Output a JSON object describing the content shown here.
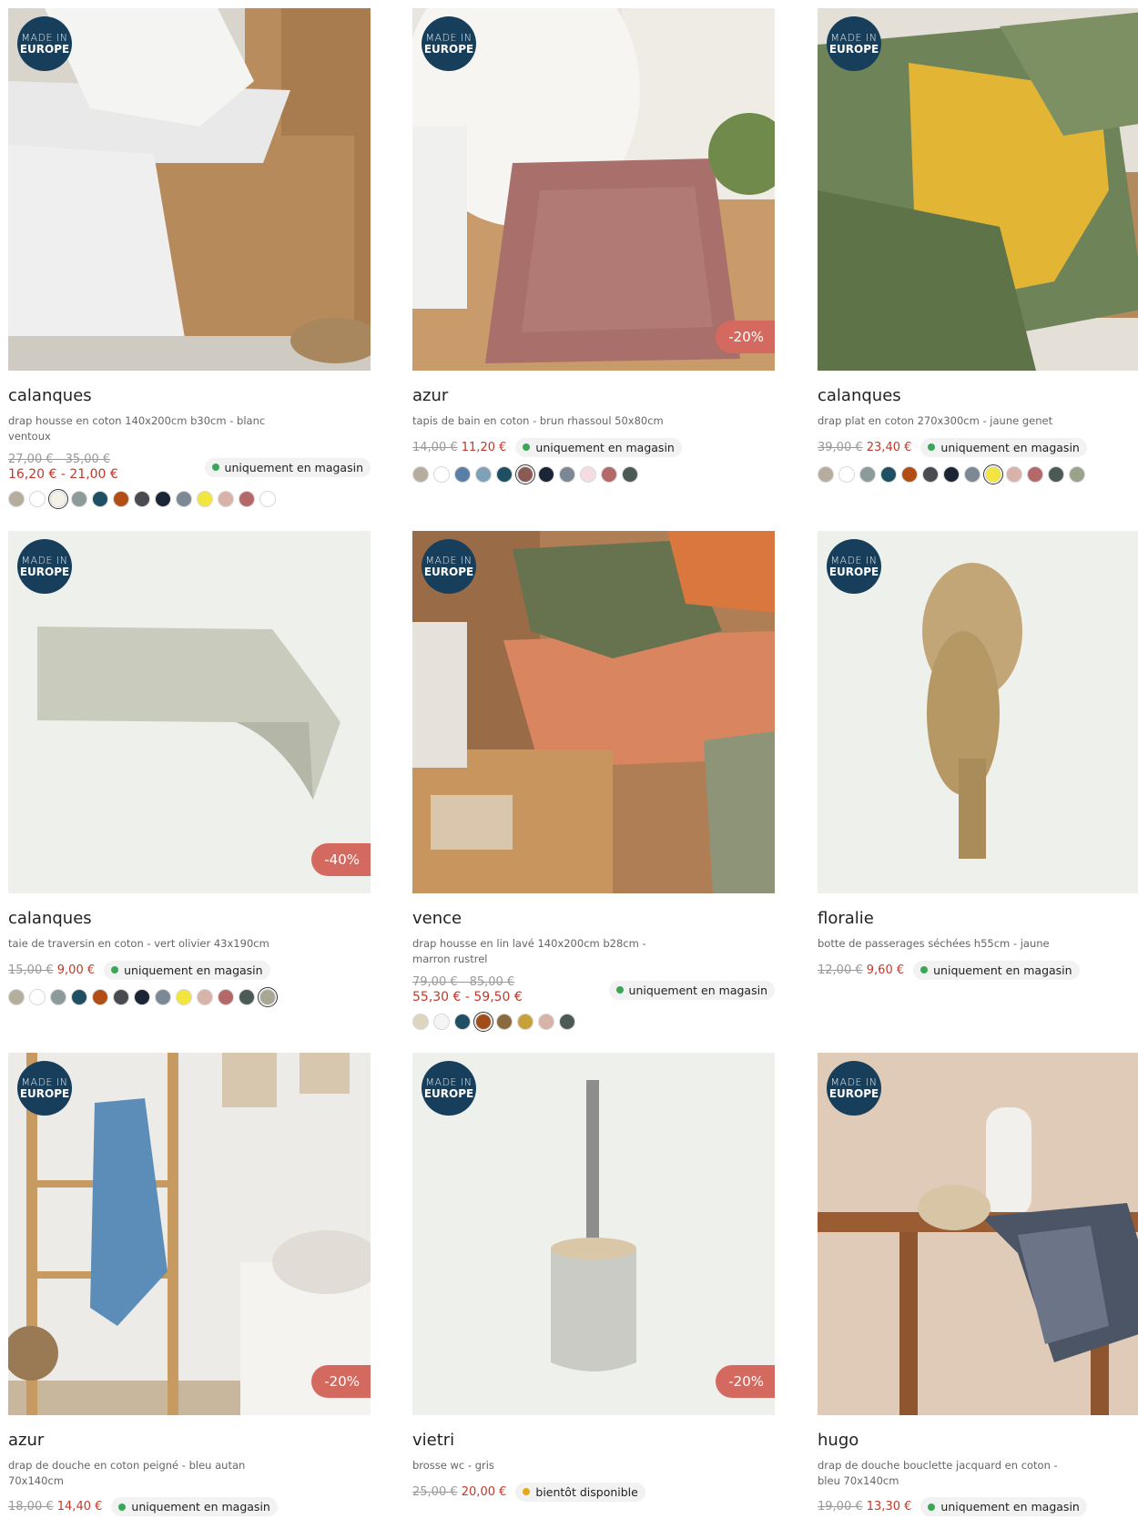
{
  "badge": {
    "line1": "MADE IN",
    "line2": "EUROPE"
  },
  "products": [
    {
      "name": "calanques",
      "desc": "drap housse en coton 140x200cm b30cm - blanc ventoux",
      "old_price": "27,00 € - 35,00 €",
      "new_price": "16,20 € - 21,00 €",
      "stock": "uniquement en magasin",
      "stock_status": "available",
      "discount": "",
      "swatches": [
        "#b5ad9d",
        "#ffffff",
        "#f4f1e8",
        "#8c9a9a",
        "#1f4f63",
        "#b14e16",
        "#4a4b50",
        "#1b2536",
        "#7d8895",
        "#f3e540",
        "#d7b3aa",
        "#b5686a",
        "#ffffff"
      ],
      "selected": 2
    },
    {
      "name": "azur",
      "desc": "tapis de bain en coton - brun rhassoul 50x80cm",
      "old_price": "14,00 €",
      "new_price": "11,20 €",
      "stock": "uniquement en magasin",
      "stock_status": "available",
      "discount": "-20%",
      "swatches": [
        "#b5ad9d",
        "#ffffff",
        "#5a7ea5",
        "#7fa1b8",
        "#1f4f63",
        "#8a5a55",
        "#1b2536",
        "#7d8895",
        "#f3dde2",
        "#b5686a",
        "#4c5a55"
      ],
      "selected": 5
    },
    {
      "name": "calanques",
      "desc": "drap plat en coton 270x300cm - jaune genet",
      "old_price": "39,00 €",
      "new_price": "23,40 €",
      "stock": "uniquement en magasin",
      "stock_status": "available",
      "discount": "",
      "swatches": [
        "#b5ad9d",
        "#ffffff",
        "#8c9a9a",
        "#1f4f63",
        "#b14e16",
        "#4a4b50",
        "#1b2536",
        "#7d8895",
        "#f3e540",
        "#d7b3aa",
        "#b5686a",
        "#4c5a55",
        "#98a38a"
      ],
      "selected": 8
    },
    {
      "name": "calanques",
      "desc": "taie de traversin en coton - vert olivier 43x190cm",
      "old_price": "15,00 €",
      "new_price": "9,00 €",
      "stock": "uniquement en magasin",
      "stock_status": "available",
      "discount": "-40%",
      "swatches": [
        "#b5ad9d",
        "#ffffff",
        "#8c9a9a",
        "#1f4f63",
        "#b14e16",
        "#4a4b50",
        "#1b2536",
        "#7d8895",
        "#f3e540",
        "#d7b3aa",
        "#b5686a",
        "#4c5a55",
        "#a8a796"
      ],
      "selected": 12
    },
    {
      "name": "vence",
      "desc": "drap housse en lin lavé 140x200cm b28cm - marron rustrel",
      "old_price": "79,00 € - 85,00 €",
      "new_price": "55,30 € - 59,50 €",
      "stock": "uniquement en magasin",
      "stock_status": "available",
      "discount": "",
      "swatches": [
        "#ddd4c2",
        "#f5f5f5",
        "#1f4f63",
        "#a04d1a",
        "#8a6a3e",
        "#c9a13a",
        "#d7b3aa",
        "#4c5a55"
      ],
      "selected": 3
    },
    {
      "name": "floralie",
      "desc": "botte de passerages séchées h55cm - jaune",
      "old_price": "12,00 €",
      "new_price": "9,60 €",
      "stock": "uniquement en magasin",
      "stock_status": "available",
      "discount": "",
      "swatches": [],
      "selected": -1
    },
    {
      "name": "azur",
      "desc": "drap de douche en coton peigné - bleu autan 70x140cm",
      "old_price": "18,00 €",
      "new_price": "14,40 €",
      "stock": "uniquement en magasin",
      "stock_status": "available",
      "discount": "-20%",
      "swatches": [],
      "selected": -1
    },
    {
      "name": "vietri",
      "desc": "brosse wc - gris",
      "old_price": "25,00 €",
      "new_price": "20,00 €",
      "stock": "bientôt disponible",
      "stock_status": "soon",
      "discount": "-20%",
      "swatches": [],
      "selected": -1
    },
    {
      "name": "hugo",
      "desc": "drap de douche bouclette jacquard en coton - bleu 70x140cm",
      "old_price": "19,00 €",
      "new_price": "13,30 €",
      "stock": "uniquement en magasin",
      "stock_status": "available",
      "discount": "",
      "swatches": [],
      "selected": -1
    }
  ]
}
